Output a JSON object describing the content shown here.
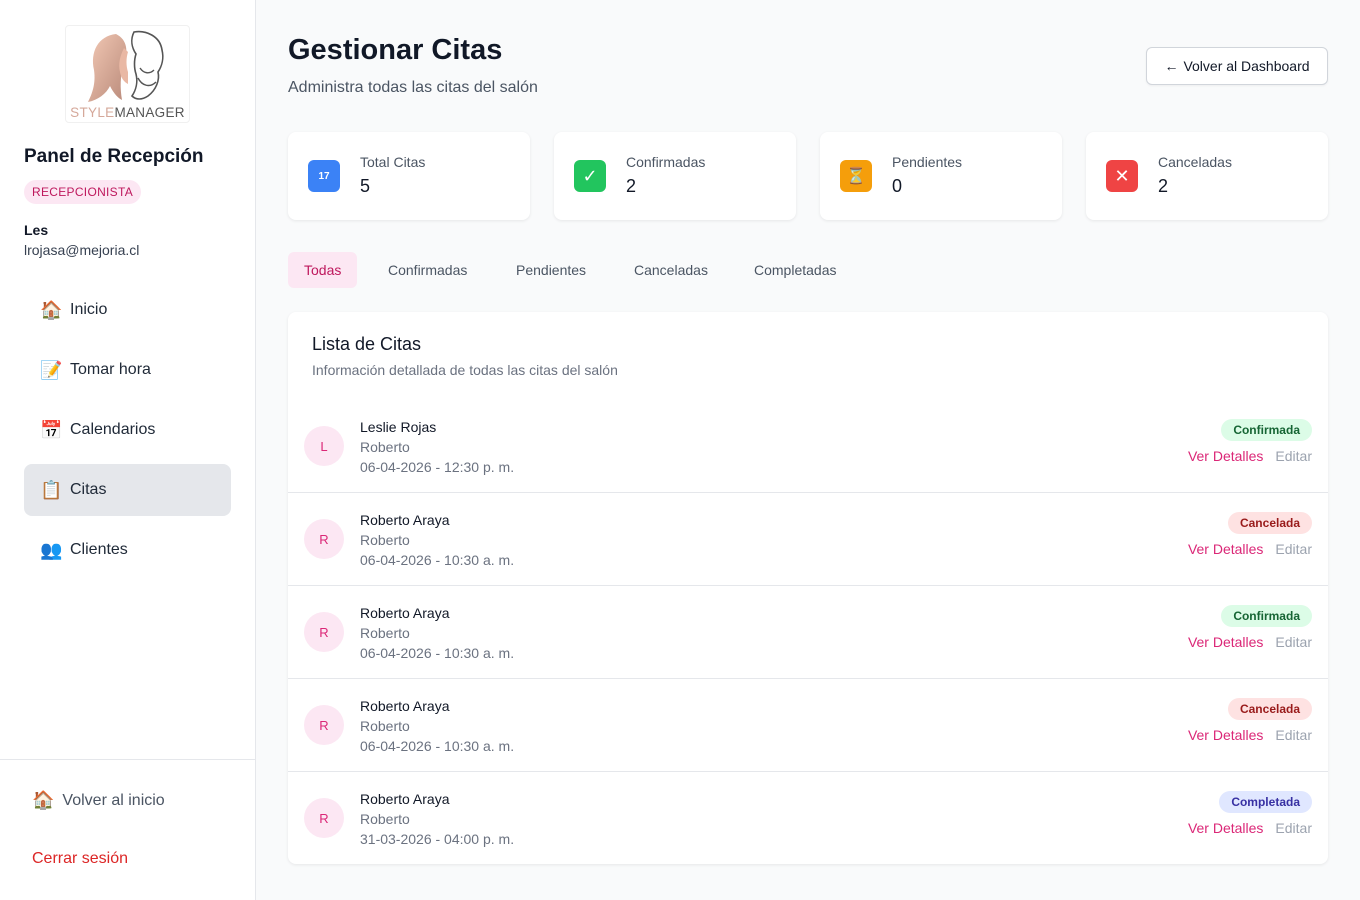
{
  "sidebar": {
    "logo": {
      "text_a": "STYLE",
      "text_b": "MANAGER"
    },
    "panel_title": "Panel de Recepción",
    "role": "RECEPCIONISTA",
    "user": {
      "name": "Les",
      "email": "lrojasa@mejoria.cl"
    },
    "nav": [
      {
        "icon": "🏠",
        "icon_name": "house-icon",
        "label": "Inicio"
      },
      {
        "icon": "📝",
        "icon_name": "memo-icon",
        "label": "Tomar hora"
      },
      {
        "icon": "📅",
        "icon_name": "calendar-icon",
        "label": "Calendarios"
      },
      {
        "icon": "📋",
        "icon_name": "clipboard-icon",
        "label": "Citas",
        "active": true
      },
      {
        "icon": "👥",
        "icon_name": "people-icon",
        "label": "Clientes"
      }
    ],
    "back_home": {
      "icon": "🏠",
      "label": "Volver al inicio"
    },
    "logout": "Cerrar sesión"
  },
  "header": {
    "title": "Gestionar Citas",
    "subtitle": "Administra todas las citas del salón",
    "back_button": "Volver al Dashboard",
    "back_arrow": "←"
  },
  "stats": [
    {
      "label": "Total Citas",
      "value": "5",
      "icon": "17",
      "icon_name": "calendar-icon",
      "color": "#3b82f6"
    },
    {
      "label": "Confirmadas",
      "value": "2",
      "icon": "✓",
      "icon_name": "check-icon",
      "color": "#22c55e"
    },
    {
      "label": "Pendientes",
      "value": "0",
      "icon": "⏳",
      "icon_name": "hourglass-icon",
      "color": "#f59e0b"
    },
    {
      "label": "Canceladas",
      "value": "2",
      "icon": "✕",
      "icon_name": "cross-icon",
      "color": "#ef4444"
    }
  ],
  "tabs": [
    {
      "label": "Todas",
      "active": true
    },
    {
      "label": "Confirmadas"
    },
    {
      "label": "Pendientes"
    },
    {
      "label": "Canceladas"
    },
    {
      "label": "Completadas"
    }
  ],
  "list": {
    "title": "Lista de Citas",
    "subtitle": "Información detallada de todas las citas del salón",
    "view_label": "Ver Detalles",
    "edit_label": "Editar",
    "rows": [
      {
        "initial": "L",
        "name": "Leslie Rojas",
        "stylist": "Roberto",
        "datetime": "06-04-2026 - 12:30 p. m.",
        "status": "Confirmada",
        "status_type": "conf"
      },
      {
        "initial": "R",
        "name": "Roberto Araya",
        "stylist": "Roberto",
        "datetime": "06-04-2026 - 10:30 a. m.",
        "status": "Cancelada",
        "status_type": "canc"
      },
      {
        "initial": "R",
        "name": "Roberto Araya",
        "stylist": "Roberto",
        "datetime": "06-04-2026 - 10:30 a. m.",
        "status": "Confirmada",
        "status_type": "conf"
      },
      {
        "initial": "R",
        "name": "Roberto Araya",
        "stylist": "Roberto",
        "datetime": "06-04-2026 - 10:30 a. m.",
        "status": "Cancelada",
        "status_type": "canc"
      },
      {
        "initial": "R",
        "name": "Roberto Araya",
        "stylist": "Roberto",
        "datetime": "31-03-2026 - 04:00 p. m.",
        "status": "Completada",
        "status_type": "comp"
      }
    ]
  }
}
